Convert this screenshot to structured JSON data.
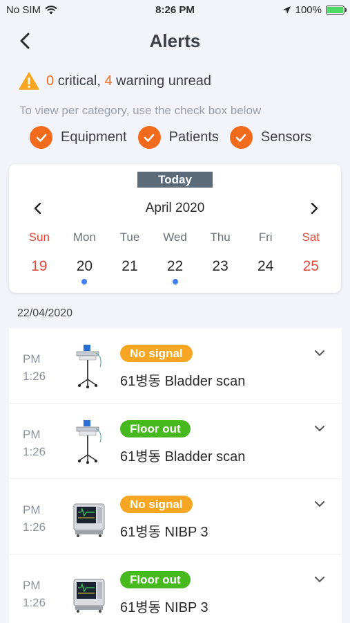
{
  "status_bar": {
    "carrier": "No SIM",
    "time": "8:26 PM",
    "battery_percent": "100%"
  },
  "header": {
    "title": "Alerts"
  },
  "summary": {
    "critical_count": "0",
    "critical_label": "critical,",
    "warning_count": "4",
    "warning_label": "warning unread"
  },
  "hint": "To view per category, use the check box below",
  "filters": [
    {
      "label": "Equipment",
      "checked": true
    },
    {
      "label": "Patients",
      "checked": true
    },
    {
      "label": "Sensors",
      "checked": true
    }
  ],
  "calendar": {
    "today_label": "Today",
    "month": "April 2020",
    "weekdays": [
      "Sun",
      "Mon",
      "Tue",
      "Wed",
      "Thu",
      "Fri",
      "Sat"
    ],
    "dates": [
      "19",
      "20",
      "21",
      "22",
      "23",
      "24",
      "25"
    ],
    "dates_with_events": [
      "20",
      "22"
    ]
  },
  "section_date": "22/04/2020",
  "alerts": [
    {
      "period": "PM",
      "time": "1:26",
      "badge": "No signal",
      "badge_color": "#f7a623",
      "name": "61병동 Bladder scan",
      "device_icon": "bladder-scanner-icon"
    },
    {
      "period": "PM",
      "time": "1:26",
      "badge": "Floor out",
      "badge_color": "#46b91e",
      "name": "61병동 Bladder scan",
      "device_icon": "bladder-scanner-icon"
    },
    {
      "period": "PM",
      "time": "1:26",
      "badge": "No signal",
      "badge_color": "#f7a623",
      "name": "61병동 NIBP 3",
      "device_icon": "nibp-monitor-icon"
    },
    {
      "period": "PM",
      "time": "1:26",
      "badge": "Floor out",
      "badge_color": "#46b91e",
      "name": "61병동 NIBP 3",
      "device_icon": "nibp-monitor-icon"
    }
  ],
  "colors": {
    "accent_orange": "#f26a1b",
    "weekend_red": "#e0483b",
    "event_dot_blue": "#3f7ff2",
    "badge_orange": "#f7a623",
    "badge_green": "#46b91e"
  }
}
